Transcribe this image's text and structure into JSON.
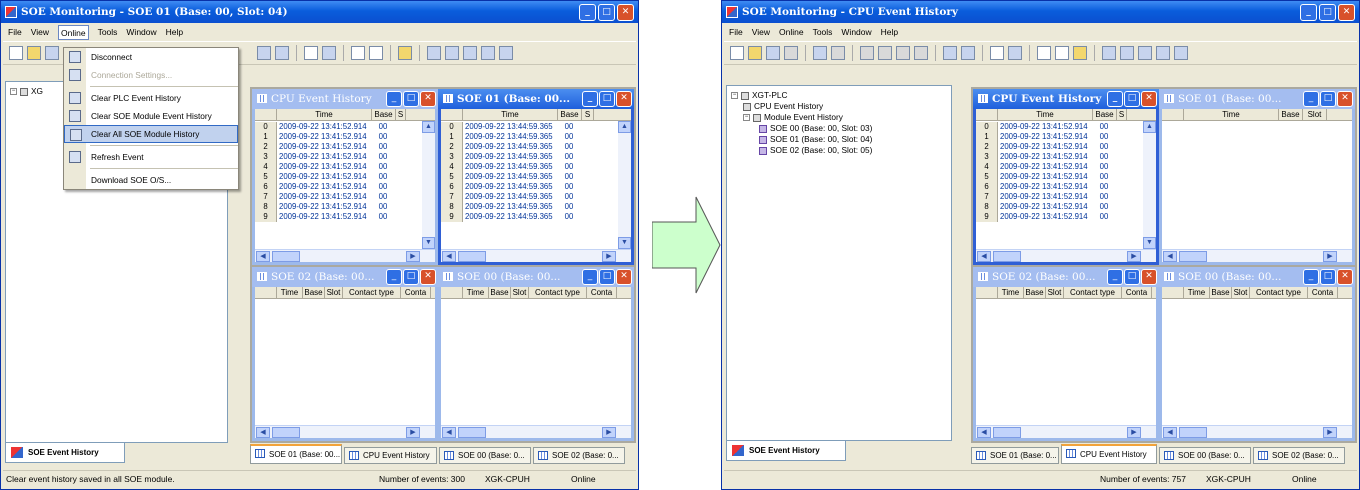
{
  "left": {
    "title": "SOE Monitoring - SOE 01 (Base: 00, Slot: 04)",
    "menu": [
      "File",
      "View",
      "Online",
      "Tools",
      "Window",
      "Help"
    ],
    "active_menu": "Online",
    "dropdown": [
      {
        "label": "Disconnect",
        "disabled": false,
        "icon": "disconnect-icon"
      },
      {
        "label": "Connection Settings...",
        "disabled": true,
        "icon": "connection-settings-icon"
      },
      {
        "sep": true
      },
      {
        "label": "Clear PLC Event History",
        "disabled": false,
        "icon": "clear-plc-icon"
      },
      {
        "label": "Clear SOE Module Event History",
        "disabled": false,
        "icon": "clear-soe-module-icon"
      },
      {
        "label": "Clear All SOE Module History",
        "disabled": false,
        "icon": "clear-all-icon",
        "highlighted": true
      },
      {
        "sep": true
      },
      {
        "label": "Refresh Event",
        "disabled": false,
        "icon": "refresh-icon"
      },
      {
        "sep": true
      },
      {
        "label": "Download SOE O/S...",
        "disabled": false,
        "icon": ""
      }
    ],
    "tree_root": "XG",
    "side_tab": "SOE Event History",
    "windows": {
      "cpu": {
        "title": "CPU Event History",
        "rows": [
          {
            "n": "0",
            "t": "2009-09-22 13:41:52.914",
            "b": "00"
          },
          {
            "n": "1",
            "t": "2009-09-22 13:41:52.914",
            "b": "00"
          },
          {
            "n": "2",
            "t": "2009-09-22 13:41:52.914",
            "b": "00"
          },
          {
            "n": "3",
            "t": "2009-09-22 13:41:52.914",
            "b": "00"
          },
          {
            "n": "4",
            "t": "2009-09-22 13:41:52.914",
            "b": "00"
          },
          {
            "n": "5",
            "t": "2009-09-22 13:41:52.914",
            "b": "00"
          },
          {
            "n": "6",
            "t": "2009-09-22 13:41:52.914",
            "b": "00"
          },
          {
            "n": "7",
            "t": "2009-09-22 13:41:52.914",
            "b": "00"
          },
          {
            "n": "8",
            "t": "2009-09-22 13:41:52.914",
            "b": "00"
          },
          {
            "n": "9",
            "t": "2009-09-22 13:41:52.914",
            "b": "00"
          }
        ]
      },
      "soe01": {
        "title": "SOE 01 (Base: 00...",
        "rows": [
          {
            "n": "0",
            "t": "2009-09-22 13:44:59.365",
            "b": "00"
          },
          {
            "n": "1",
            "t": "2009-09-22 13:44:59.365",
            "b": "00"
          },
          {
            "n": "2",
            "t": "2009-09-22 13:44:59.365",
            "b": "00"
          },
          {
            "n": "3",
            "t": "2009-09-22 13:44:59.365",
            "b": "00"
          },
          {
            "n": "4",
            "t": "2009-09-22 13:44:59.365",
            "b": "00"
          },
          {
            "n": "5",
            "t": "2009-09-22 13:44:59.365",
            "b": "00"
          },
          {
            "n": "6",
            "t": "2009-09-22 13:44:59.365",
            "b": "00"
          },
          {
            "n": "7",
            "t": "2009-09-22 13:44:59.365",
            "b": "00"
          },
          {
            "n": "8",
            "t": "2009-09-22 13:44:59.365",
            "b": "00"
          },
          {
            "n": "9",
            "t": "2009-09-22 13:44:59.365",
            "b": "00"
          }
        ]
      },
      "soe02": {
        "title": "SOE 02 (Base: 00..."
      },
      "soe00": {
        "title": "SOE 00 (Base: 00..."
      }
    },
    "tabs": [
      "SOE 01 (Base: 00...",
      "CPU Event History",
      "SOE 00 (Base: 0...",
      "SOE 02 (Base: 0..."
    ],
    "selected_tab": 0,
    "status": {
      "message": "Clear event history saved in all SOE module.",
      "events": "Number of events: 300",
      "cpu": "XGK-CPUH",
      "state": "Online"
    }
  },
  "right": {
    "title": "SOE Monitoring - CPU Event History",
    "menu": [
      "File",
      "View",
      "Online",
      "Tools",
      "Window",
      "Help"
    ],
    "tree": [
      {
        "label": "XGT-PLC",
        "level": 0
      },
      {
        "label": "CPU Event History",
        "level": 1
      },
      {
        "label": "Module Event History",
        "level": 1
      },
      {
        "label": "SOE 00 (Base: 00, Slot: 03)",
        "level": 2
      },
      {
        "label": "SOE 01 (Base: 00, Slot: 04)",
        "level": 2
      },
      {
        "label": "SOE 02 (Base: 00, Slot: 05)",
        "level": 2
      }
    ],
    "side_tab": "SOE Event History",
    "windows": {
      "cpu": {
        "title": "CPU Event History",
        "rows": [
          {
            "n": "0",
            "t": "2009-09-22 13:41:52.914",
            "b": "00"
          },
          {
            "n": "1",
            "t": "2009-09-22 13:41:52.914",
            "b": "00"
          },
          {
            "n": "2",
            "t": "2009-09-22 13:41:52.914",
            "b": "00"
          },
          {
            "n": "3",
            "t": "2009-09-22 13:41:52.914",
            "b": "00"
          },
          {
            "n": "4",
            "t": "2009-09-22 13:41:52.914",
            "b": "00"
          },
          {
            "n": "5",
            "t": "2009-09-22 13:41:52.914",
            "b": "00"
          },
          {
            "n": "6",
            "t": "2009-09-22 13:41:52.914",
            "b": "00"
          },
          {
            "n": "7",
            "t": "2009-09-22 13:41:52.914",
            "b": "00"
          },
          {
            "n": "8",
            "t": "2009-09-22 13:41:52.914",
            "b": "00"
          },
          {
            "n": "9",
            "t": "2009-09-22 13:41:52.914",
            "b": "00"
          }
        ]
      },
      "soe01": {
        "title": "SOE 01 (Base: 00..."
      },
      "soe02": {
        "title": "SOE 02 (Base: 00..."
      },
      "soe00": {
        "title": "SOE 00 (Base: 00..."
      }
    },
    "tabs": [
      "SOE 01 (Base: 0...",
      "CPU Event History",
      "SOE 00 (Base: 0...",
      "SOE 02 (Base: 0..."
    ],
    "selected_tab": 1,
    "status": {
      "message": "",
      "events": "Number of events: 757",
      "cpu": "XGK-CPUH",
      "state": "Online"
    }
  },
  "columns": {
    "time": "Time",
    "base": "Base",
    "slot": "Slot",
    "contact_type": "Contact type",
    "contact": "Conta",
    "s": "S"
  },
  "colors": {
    "title_blue": "#0a5ddc",
    "arrow_fill": "#ccffcc"
  }
}
